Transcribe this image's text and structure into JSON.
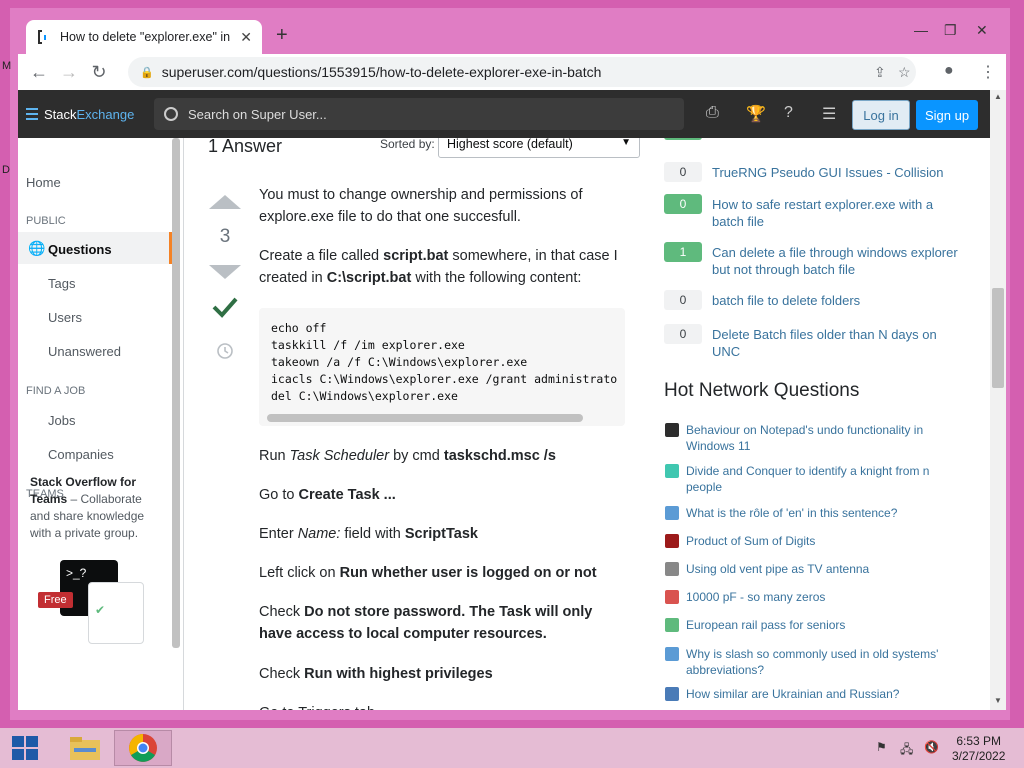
{
  "browser": {
    "tab_title": "How to delete \"explorer.exe\" in b",
    "new_tab": "+",
    "url": "superuser.com/questions/1553915/how-to-delete-explorer-exe-in-batch",
    "min": "—",
    "max": "❐",
    "close": "✕"
  },
  "site": {
    "logo_a": "Stack",
    "logo_b": "Exchange",
    "search_placeholder": "Search on Super User...",
    "login": "Log in",
    "signup": "Sign up"
  },
  "sidenav": {
    "home": "Home",
    "public": "PUBLIC",
    "questions": "Questions",
    "tags": "Tags",
    "users": "Users",
    "unanswered": "Unanswered",
    "find_job": "FIND A JOB",
    "jobs": "Jobs",
    "companies": "Companies",
    "teams": "TEAMS",
    "teams_title": "Stack Overflow for Teams",
    "teams_text": " – Collaborate and share knowledge with a private group.",
    "free": "Free"
  },
  "answers_header": {
    "count": "1 Answer",
    "sorted_by": "Sorted by:",
    "sort_value": "Highest score (default)"
  },
  "answer": {
    "score": "3",
    "p1": "You must to change ownership and permissions of explore.exe file to do that one succesfull.",
    "p2_a": "Create a file called ",
    "p2_b": "script.bat",
    "p2_c": " somewhere, in that case I created in ",
    "p2_d": "C:\\script.bat",
    "p2_e": " with the following content:",
    "code": "echo off\ntaskkill /f /im explorer.exe\ntakeown /a /f C:\\Windows\\explorer.exe\nicacls C:\\Windows\\explorer.exe /grant administrato\ndel C:\\Windows\\explorer.exe",
    "p3_a": "Run ",
    "p3_b": "Task Scheduler",
    "p3_c": " by cmd ",
    "p3_d": "taskschd.msc /s",
    "p4_a": "Go to ",
    "p4_b": "Create Task ...",
    "p5_a": "Enter ",
    "p5_b": "Name:",
    "p5_c": " field with ",
    "p5_d": "ScriptTask",
    "p6_a": "Left click on ",
    "p6_b": "Run whether user is logged on or not",
    "p7_a": "Check ",
    "p7_b": "Do not store password. The Task will only have access to local computer resources.",
    "p8_a": "Check ",
    "p8_b": "Run with highest privileges",
    "p9": "Go to Triggers tab"
  },
  "related": [
    {
      "count": "0",
      "title": "TrueRNG Pseudo GUI Issues - Collision",
      "answered": false
    },
    {
      "count": "0",
      "title": "How to safe restart explorer.exe with a batch file",
      "answered": true
    },
    {
      "count": "1",
      "title": "Can delete a file through windows explorer but not through batch file",
      "answered": true
    },
    {
      "count": "0",
      "title": "batch file to delete folders",
      "answered": false
    },
    {
      "count": "0",
      "title": "Delete Batch files older than N days on UNC",
      "answered": false
    }
  ],
  "hnq_title": "Hot Network Questions",
  "hnq": [
    "Behaviour on Notepad's undo functionality in Windows 11",
    "Divide and Conquer to identify a knight from n people",
    "What is the rôle of 'en' in this sentence?",
    "Product of Sum of Digits",
    "Using old vent pipe as TV antenna",
    "10000 pF - so many zeros",
    "European rail pass for seniors",
    "Why is slash so commonly used in old systems' abbreviations?",
    "How similar are Ukrainian and Russian?"
  ],
  "taskbar": {
    "time": "6:53 PM",
    "date": "3/27/2022"
  },
  "desktop": {
    "m": "M",
    "d": "D"
  },
  "colors": {
    "accent": "#0a95ff",
    "link": "#39739d",
    "accepted": "#2f6f44",
    "nav_active": "#f48225"
  }
}
